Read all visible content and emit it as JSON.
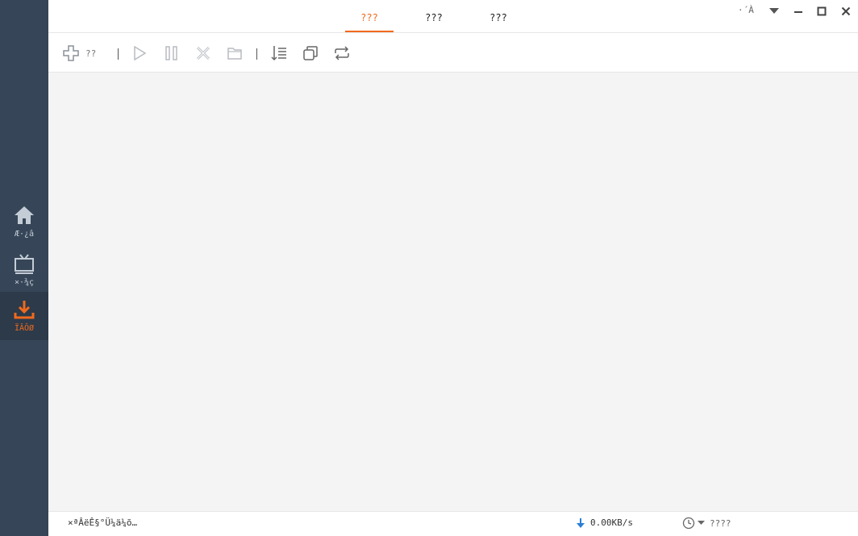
{
  "sidebar": {
    "items": [
      {
        "label": "Æ·¿â",
        "icon": "home-icon"
      },
      {
        "label": "×·¾ç",
        "icon": "tv-icon"
      },
      {
        "label": "ÏÂÔØ",
        "icon": "download-icon",
        "active": true
      }
    ]
  },
  "tabs": [
    {
      "label": "???",
      "active": true
    },
    {
      "label": "???"
    },
    {
      "label": "???"
    }
  ],
  "window": {
    "user_label": "·´À"
  },
  "toolbar": {
    "new_label": "??"
  },
  "status": {
    "text": "×ªÂëÊ§°Ü¼ä¼õ…",
    "speed": "0.00KB/s",
    "schedule_label": "????"
  },
  "colors": {
    "accent": "#f06a1d",
    "sidebar_bg": "#364658",
    "content_bg": "#f4f4f4",
    "download_arrow": "#2a7fd4"
  }
}
